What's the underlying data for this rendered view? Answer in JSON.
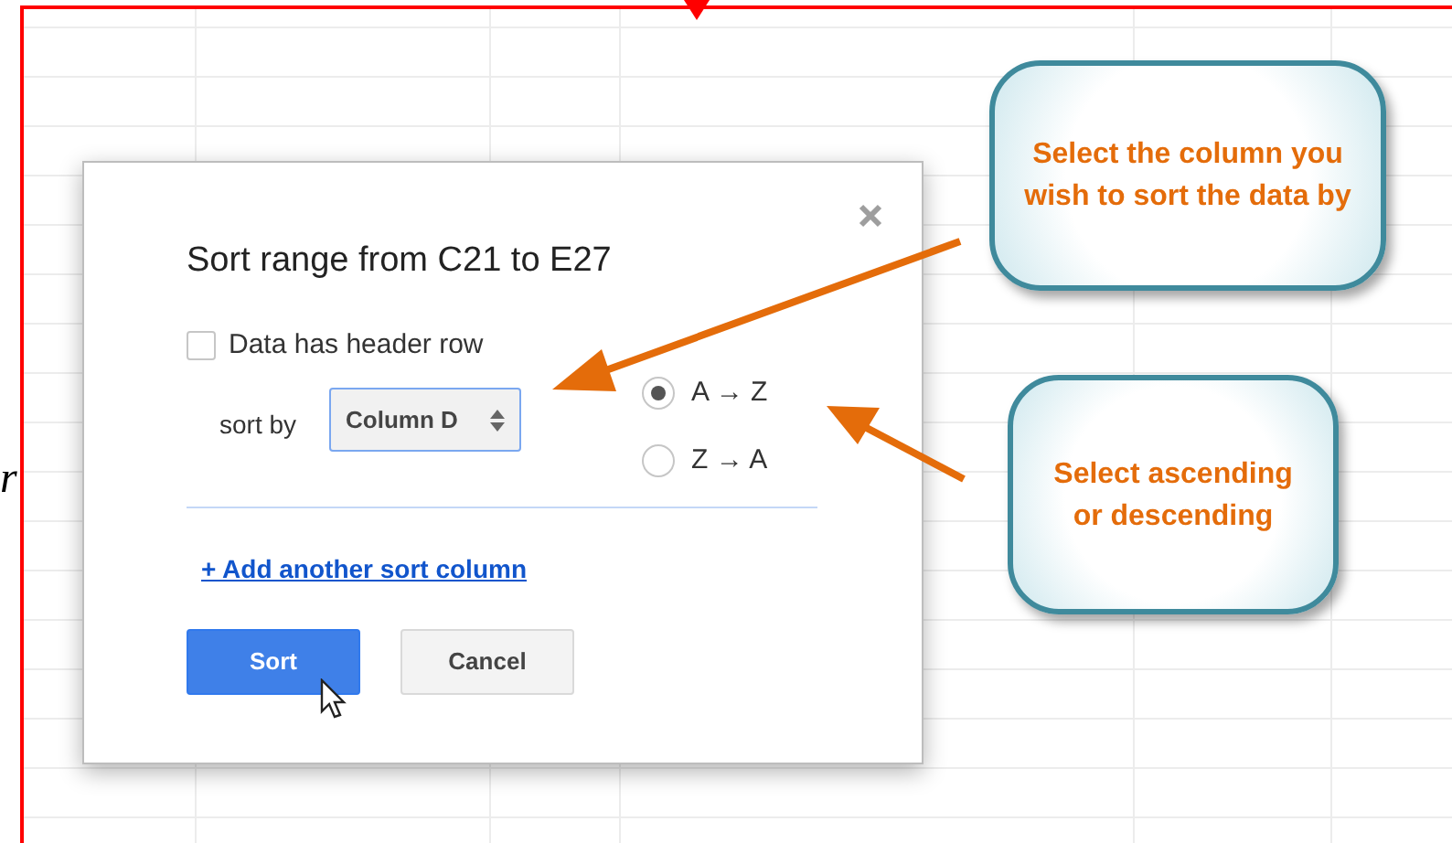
{
  "sheet": {
    "side_text": "r"
  },
  "dialog": {
    "title": "Sort range from C21 to E27",
    "header_row": {
      "label": "Data has header row",
      "checked": false
    },
    "sort_by_label": "sort by",
    "column_select": {
      "value": "Column D"
    },
    "order_options": [
      {
        "label": "A → Z",
        "selected": true
      },
      {
        "label": "Z → A",
        "selected": false
      }
    ],
    "add_link": "+ Add another sort column",
    "buttons": [
      {
        "label": "Sort",
        "kind": "primary"
      },
      {
        "label": "Cancel",
        "kind": "secondary"
      }
    ]
  },
  "callouts": [
    {
      "text": "Select the column you wish to sort the data by"
    },
    {
      "text": "Select ascending or descending"
    }
  ]
}
